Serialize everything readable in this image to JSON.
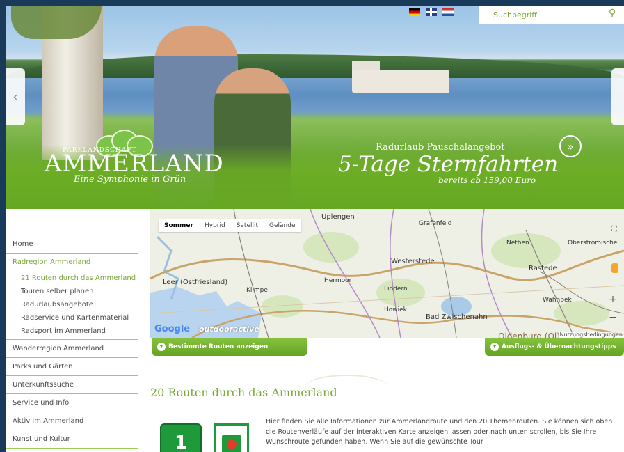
{
  "languages": [
    "de",
    "en",
    "nl"
  ],
  "search": {
    "placeholder": "Suchbegriff"
  },
  "hero": {
    "logo_small": "PARKLANDSCHAFT",
    "logo_big": "AMMERLAND",
    "logo_sub": "Eine Symphonie in Grün",
    "promo_small": "Radurlaub Pauschalangebot",
    "promo_big": "5-Tage Sternfahrten",
    "promo_price": "bereits ab 159,00 Euro"
  },
  "sidebar": {
    "items": [
      {
        "label": "Home"
      },
      {
        "label": "Radregion Ammerland"
      },
      {
        "label": "Wanderregion Ammerland"
      },
      {
        "label": "Parks und Gärten"
      },
      {
        "label": "Unterkunftssuche"
      },
      {
        "label": "Service und Info"
      },
      {
        "label": "Aktiv im Ammerland"
      },
      {
        "label": "Kunst und Kultur"
      }
    ],
    "subitems": [
      {
        "label": "21 Routen durch das Ammerland"
      },
      {
        "label": "Touren selber planen"
      },
      {
        "label": "Radurlaubsangebote"
      },
      {
        "label": "Radservice und Kartenmaterial"
      },
      {
        "label": "Radsport im Ammerland"
      }
    ]
  },
  "map": {
    "types": [
      "Sommer",
      "Hybrid",
      "Satellit",
      "Gelände"
    ],
    "places": [
      "Uplengen",
      "Grafenfeld",
      "Nethen",
      "Oberströmische",
      "Westerstede",
      "Rastede",
      "Leer (Ostfriesland)",
      "Klimpe",
      "Hermoor",
      "Lindern",
      "Howiek",
      "Bad Zwischenahn",
      "Wahnbek",
      "Oldenburg (Ol)"
    ],
    "google": "Google",
    "outdoor": "outdooractive",
    "terms": "Nutzungsbedingungen",
    "btn_routes": "Bestimmte Routen anzeigen",
    "btn_tips": "Ausflugs- & Übernachtungstipps"
  },
  "content": {
    "title": "20 Routen durch das Ammerland",
    "badge_number": "1",
    "text": "Hier finden Sie alle Informationen zur Ammerlandroute und den 20 Themenrouten. Sie können sich oben die Routenverläufe auf der interaktiven Karte anzeigen lassen oder nach unten scrollen, bis Sie Ihre Wunschroute gefunden haben. Wenn Sie auf die gewünschte Tour"
  }
}
